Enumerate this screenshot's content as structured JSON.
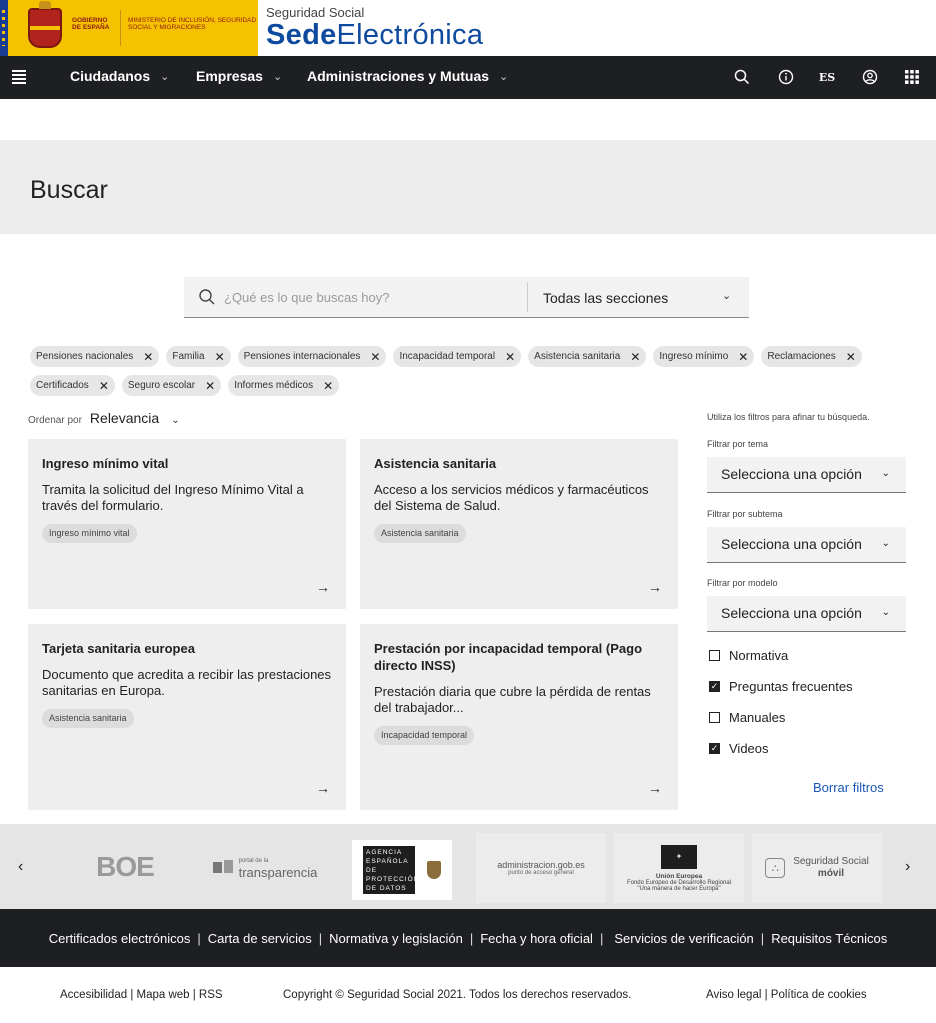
{
  "brand": {
    "gov_text": "GOBIERNO DE ESPAÑA",
    "ministry_text": "MINISTERIO DE INCLUSIÓN, SEGURIDAD SOCIAL Y MIGRACIONES",
    "sede_small": "Seguridad Social",
    "sede_bold": "Sede",
    "sede_light": "Electrónica"
  },
  "nav": {
    "items": [
      {
        "label": "Ciudadanos"
      },
      {
        "label": "Empresas"
      },
      {
        "label": "Administraciones y Mutuas"
      }
    ],
    "lang": "ES"
  },
  "page": {
    "title": "Buscar"
  },
  "search": {
    "placeholder": "¿Qué es lo que buscas hoy?",
    "value": "",
    "section": "Todas las secciones"
  },
  "chips": [
    "Pensiones nacionales",
    "Familia",
    "Pensiones internacionales",
    "Incapacidad temporal",
    "Asistencia sanitaria",
    "Ingreso mínimo",
    "Reclamaciones",
    "Certificados",
    "Seguro escolar",
    "Informes médicos"
  ],
  "sort": {
    "label": "Ordenar por",
    "value": "Relevancia"
  },
  "cards": [
    {
      "title": "Ingreso mínimo vital",
      "desc": "Tramita la solicitud del Ingreso Mínimo Vital a través del formulario.",
      "tag": "Ingreso mínimo vital"
    },
    {
      "title": "Asistencia sanitaria",
      "desc": "Acceso a los servicios médicos y farmacéuticos del Sistema de Salud.",
      "tag": "Asistencia sanitaria"
    },
    {
      "title": "Tarjeta sanitaria europea",
      "desc": "Documento que acredita a recibir las prestaciones sanitarias en Europa.",
      "tag": "Asistencia sanitaria"
    },
    {
      "title": "Prestación por incapacidad temporal (Pago directo INSS)",
      "desc": "Prestación diaria que cubre la pérdida de rentas del trabajador...",
      "tag": "Incapacidad temporal"
    }
  ],
  "filters": {
    "hint": "Utiliza los filtros para afinar tu búsqueda.",
    "tema_label": "Filtrar por tema",
    "subtema_label": "Filtrar por subtema",
    "modelo_label": "Filtrar por modelo",
    "select_placeholder": "Selecciona una opción",
    "checks": [
      {
        "label": "Normativa",
        "checked": false
      },
      {
        "label": "Preguntas frecuentes",
        "checked": true
      },
      {
        "label": "Manuales",
        "checked": false
      },
      {
        "label": "Videos",
        "checked": true
      }
    ],
    "clear": "Borrar filtros"
  },
  "logos": {
    "boe": "BOE",
    "transparencia_small": "portal de la",
    "transparencia": "transparencia",
    "aepd": "AGENCIA ESPAÑOLA DE PROTECCIÓN DE DATOS",
    "admin": "administracion.gob.es",
    "admin_sub": "punto de acceso general",
    "eu_title": "Unión Europea",
    "eu_sub": "Fondo Europeo de Desarrollo Regional",
    "eu_motto": "\"Una manera de hacer Europa\"",
    "ss_movil_1": "Seguridad Social",
    "ss_movil_2": "móvil"
  },
  "footer": {
    "links": [
      "Certificados electrónicos",
      "Carta de servicios",
      "Normativa y legislación",
      "Fecha y hora oficial",
      "Servicios de verificación",
      "Requisitos Técnicos"
    ],
    "left": "Accesibilidad | Mapa web | RSS",
    "copyright": "Copyright © Seguridad Social 2021. Todos los derechos reservados.",
    "right": "Aviso legal | Política de cookies"
  }
}
